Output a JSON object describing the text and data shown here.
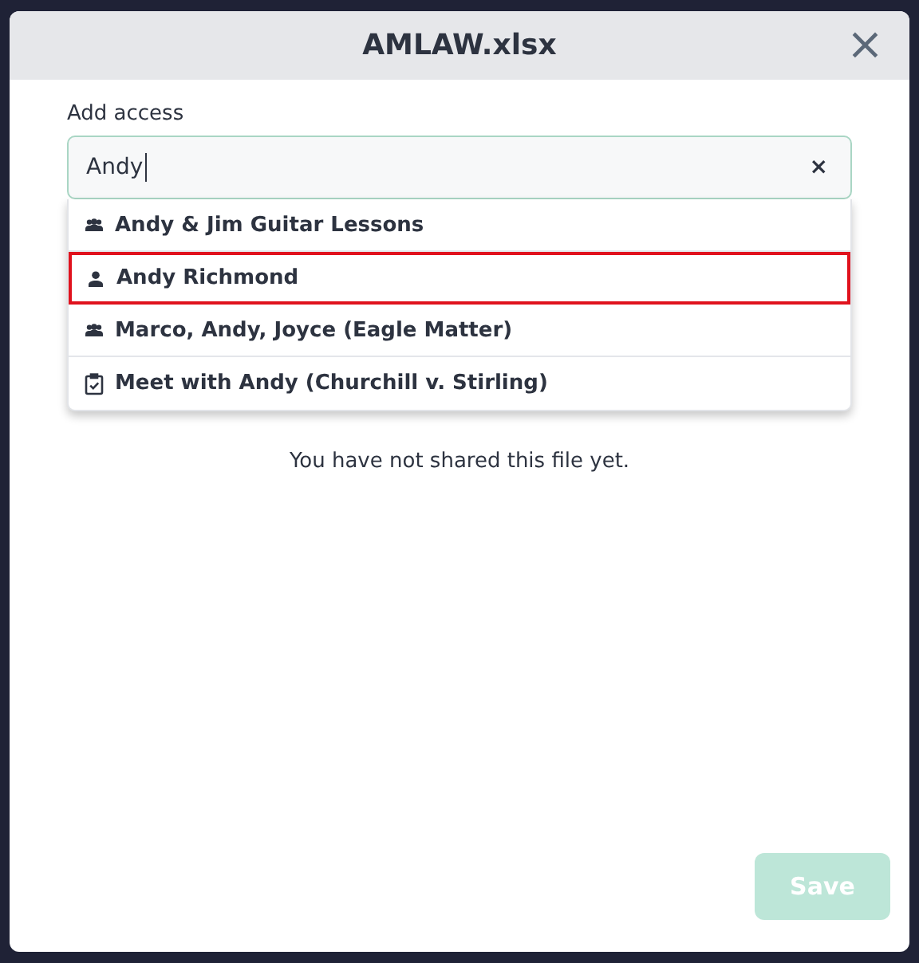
{
  "dialog": {
    "title": "AMLAW.xlsx",
    "close": "×"
  },
  "access": {
    "label": "Add access",
    "value": "Andy",
    "clear": "×"
  },
  "suggestions": [
    {
      "kind": "group",
      "label": "Andy & Jim Guitar Lessons",
      "selected": false
    },
    {
      "kind": "person",
      "label": "Andy Richmond",
      "selected": true
    },
    {
      "kind": "group",
      "label": "Marco, Andy, Joyce (Eagle Matter)",
      "selected": false
    },
    {
      "kind": "task",
      "label": "Meet with Andy (Churchill v. Stirling)",
      "selected": false
    }
  ],
  "message": "You have not shared this file yet.",
  "save_button": {
    "label": "Save",
    "disabled": true
  }
}
